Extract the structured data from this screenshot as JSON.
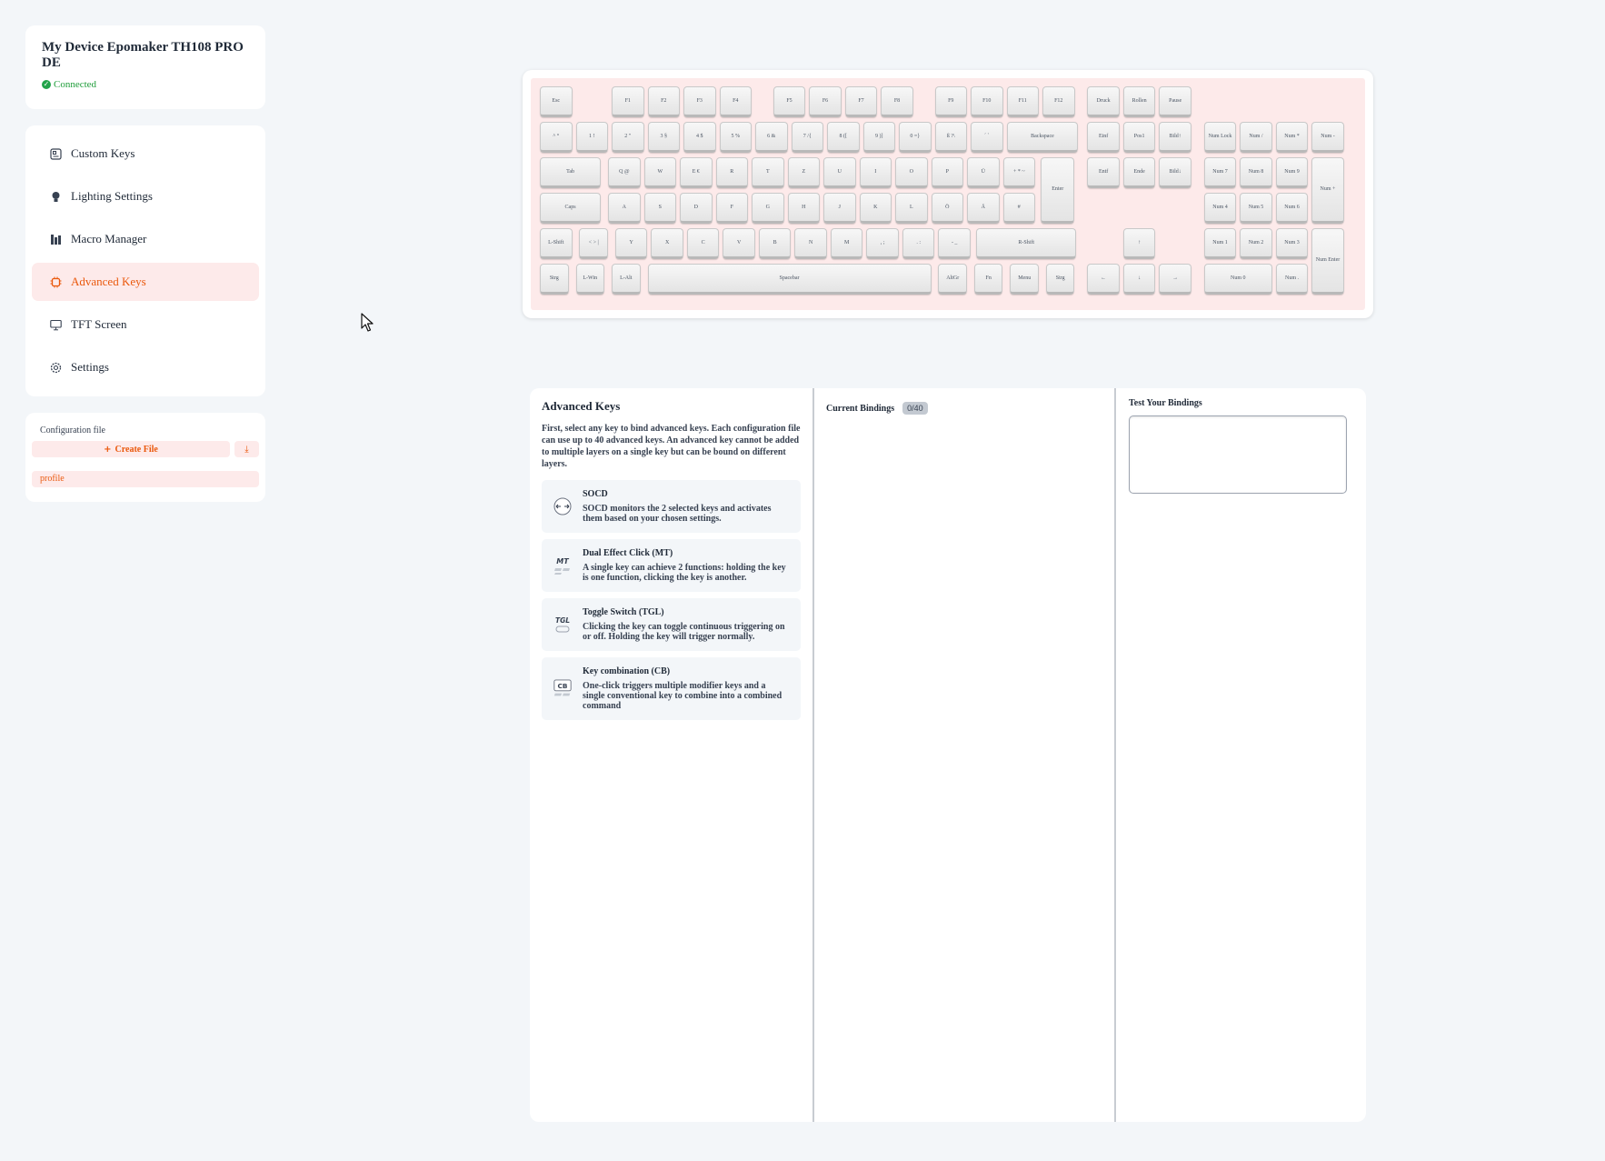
{
  "device": {
    "title": "My Device Epomaker TH108 PRO DE",
    "status": "Connected"
  },
  "nav": [
    {
      "label": "Custom Keys",
      "icon": "custom-keys-icon",
      "active": false
    },
    {
      "label": "Lighting Settings",
      "icon": "bulb-icon",
      "active": false
    },
    {
      "label": "Macro Manager",
      "icon": "macro-icon",
      "active": false
    },
    {
      "label": "Advanced Keys",
      "icon": "chip-icon",
      "active": true
    },
    {
      "label": "TFT Screen",
      "icon": "monitor-icon",
      "active": false
    },
    {
      "label": "Settings",
      "icon": "gear-icon",
      "active": false
    }
  ],
  "config": {
    "label": "Configuration file",
    "create_label": "Create File",
    "profile": "profile"
  },
  "keyboard": {
    "rows": [
      [
        "Esc",
        "F1",
        "F2",
        "F3",
        "F4",
        "F5",
        "F6",
        "F7",
        "F8",
        "F9",
        "F10",
        "F11",
        "F12",
        "Druck",
        "Rollen",
        "Pause"
      ],
      [
        "^ °",
        "1 !",
        "2 \"",
        "3 §",
        "4 $",
        "5 %",
        "6 &",
        "7 /{",
        "8 ([",
        "9 )]",
        "0 =}",
        "ß ?\\",
        "´ `",
        "Backspace",
        "Einf",
        "Pos1",
        "Bild↑",
        "Num Lock",
        "Num /",
        "Num *",
        "Num -"
      ],
      [
        "Tab",
        "Q @",
        "W",
        "E €",
        "R",
        "T",
        "Z",
        "U",
        "I",
        "O",
        "P",
        "Ü",
        "+ * ~",
        "Enter",
        "Entf",
        "Ende",
        "Bild↓",
        "Num 7",
        "Num 8",
        "Num 9",
        "Num +"
      ],
      [
        "Caps",
        "A",
        "S",
        "D",
        "F",
        "G",
        "H",
        "J",
        "K",
        "L",
        "Ö",
        "Ä",
        "#",
        "Num 4",
        "Num 5",
        "Num 6"
      ],
      [
        "L-Shift",
        "< > |",
        "Y",
        "X",
        "C",
        "V",
        "B",
        "N",
        "M",
        ", ;",
        ". :",
        "- _",
        "R-Shift",
        "↑",
        "Num 1",
        "Num 2",
        "Num 3",
        "Num Enter"
      ],
      [
        "Strg",
        "L-Win",
        "L-Alt",
        "Spacebar",
        "AltGr",
        "Fn",
        "Menu",
        "Strg",
        "←",
        "↓",
        "→",
        "Num 0",
        "Num ."
      ]
    ]
  },
  "advanced": {
    "title": "Advanced Keys",
    "description": "First, select any key to bind advanced keys. Each configuration file can use up to 40 advanced keys. An advanced key cannot be added to multiple layers on a single key but can be bound on different layers.",
    "items": [
      {
        "title": "SOCD",
        "desc": "SOCD monitors the 2 selected keys and activates them based on your chosen settings.",
        "icon": "socd-icon"
      },
      {
        "title": "Dual Effect Click (MT)",
        "desc": "A single key can achieve 2 functions: holding the key is one function, clicking the key is another.",
        "icon": "mt-icon",
        "icon_text": "MT"
      },
      {
        "title": "Toggle Switch (TGL)",
        "desc": "Clicking the key can toggle continuous triggering on or off. Holding the key will trigger normally.",
        "icon": "tgl-icon",
        "icon_text": "TGL"
      },
      {
        "title": "Key combination (CB)",
        "desc": "One-click triggers multiple modifier keys and a single conventional key to combine into a combined command",
        "icon": "cb-icon",
        "icon_text": "CB"
      }
    ]
  },
  "bindings": {
    "title": "Current Bindings",
    "count": "0/40"
  },
  "test": {
    "title": "Test Your Bindings"
  },
  "colors": {
    "accent": "#ea580c",
    "accent_bg": "#fdeaea",
    "connected": "#22a34a",
    "page_bg": "#f3f6f9"
  }
}
